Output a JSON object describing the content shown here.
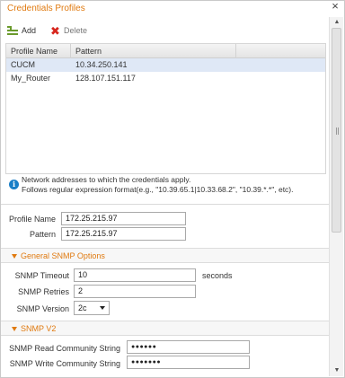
{
  "dialog": {
    "title": "Credentials Profiles",
    "close_glyph": "×"
  },
  "toolbar": {
    "add_label": "Add",
    "add_icon": "add-list-icon",
    "delete_label": "Delete",
    "delete_icon": "delete-x-icon",
    "delete_glyph": "✖"
  },
  "table": {
    "columns": [
      "Profile Name",
      "Pattern"
    ],
    "rows": [
      {
        "name": "CUCM",
        "pattern": "10.34.250.141",
        "selected": true
      },
      {
        "name": "My_Router",
        "pattern": "128.107.151.117",
        "selected": false
      }
    ]
  },
  "info": {
    "icon": "info-icon",
    "icon_glyph": "i",
    "line1": "Network addresses to which the credentials apply.",
    "line2": "Follows regular expression format(e.g., \"10.39.65.1|10.33.68.2\", \"10.39.*.*\", etc)."
  },
  "profile": {
    "name_label": "Profile Name",
    "name_value": "172.25.215.97",
    "pattern_label": "Pattern",
    "pattern_value": "172.25.215.97"
  },
  "general_snmp": {
    "title": "General SNMP Options",
    "timeout_label": "SNMP Timeout",
    "timeout_value": "10",
    "timeout_unit": "seconds",
    "retries_label": "SNMP Retries",
    "retries_value": "2",
    "version_label": "SNMP Version",
    "version_value": "2c"
  },
  "snmp_v2": {
    "title": "SNMP V2",
    "read_label": "SNMP Read Community String",
    "read_value": "●●●●●●",
    "write_label": "SNMP Write Community String",
    "write_value": "●●●●●●●"
  },
  "colors": {
    "accent": "#e07a10",
    "selected_row": "#dfe8f6",
    "info_blue": "#1a7fc7",
    "delete_red": "#d7261e",
    "add_green": "#6a9a2c"
  }
}
